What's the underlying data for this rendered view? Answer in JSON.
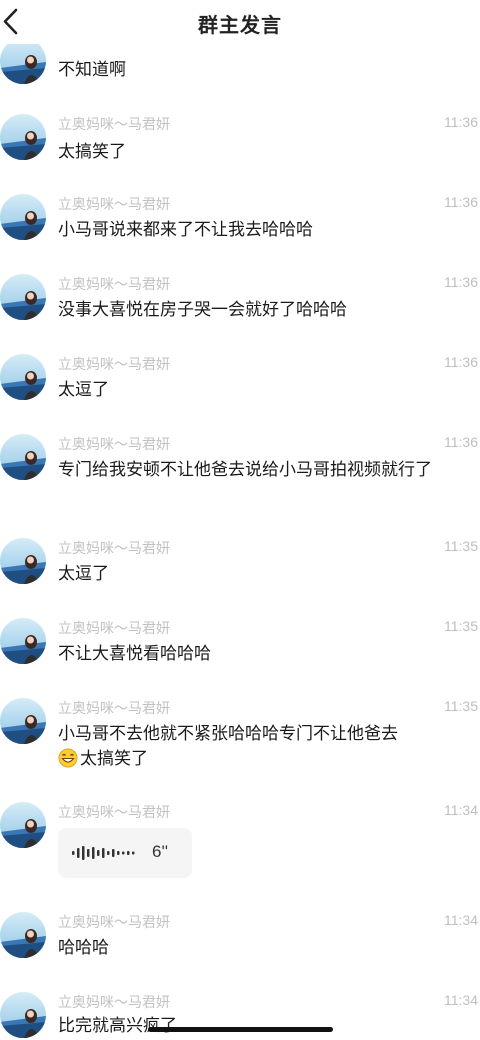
{
  "header": {
    "title": "群主发言",
    "back_icon": "chevron-left-icon"
  },
  "messages": [
    {
      "sender": "",
      "time": "",
      "text": "不知道啊"
    },
    {
      "sender": "立奥妈咪～马君妍",
      "time": "11:36",
      "text": "太搞笑了"
    },
    {
      "sender": "立奥妈咪～马君妍",
      "time": "11:36",
      "text": "小马哥说来都来了不让我去哈哈哈"
    },
    {
      "sender": "立奥妈咪～马君妍",
      "time": "11:36",
      "text": "没事大喜悦在房子哭一会就好了哈哈哈"
    },
    {
      "sender": "立奥妈咪～马君妍",
      "time": "11:36",
      "text": "太逗了"
    },
    {
      "sender": "立奥妈咪～马君妍",
      "time": "11:36",
      "text": "专门给我安顿不让他爸去说给小马哥拍视频就行了"
    },
    {
      "sender": "立奥妈咪～马君妍",
      "time": "11:35",
      "text": "太逗了"
    },
    {
      "sender": "立奥妈咪～马君妍",
      "time": "11:35",
      "text": "不让大喜悦看哈哈哈"
    },
    {
      "sender": "立奥妈咪～马君妍",
      "time": "11:35",
      "text": "小马哥不去他就不紧张哈哈哈专门不让他爸去",
      "emoji": "grinning-face-emoji",
      "text_after_emoji": "太搞笑了"
    },
    {
      "sender": "立奥妈咪～马君妍",
      "time": "11:34",
      "type": "voice",
      "voice_duration": "6''",
      "voice_icon": "voice-wave-icon"
    },
    {
      "sender": "立奥妈咪～马君妍",
      "time": "11:34",
      "text": "哈哈哈"
    },
    {
      "sender": "立奥妈咪～马君妍",
      "time": "11:34",
      "text": "比完就高兴疯了"
    }
  ],
  "colors": {
    "background": "#ffffff",
    "sender_text": "#c2c2c2",
    "time_text": "#bfbfbf",
    "message_text": "#1a1a1a",
    "voice_bubble": "#f5f5f5"
  }
}
